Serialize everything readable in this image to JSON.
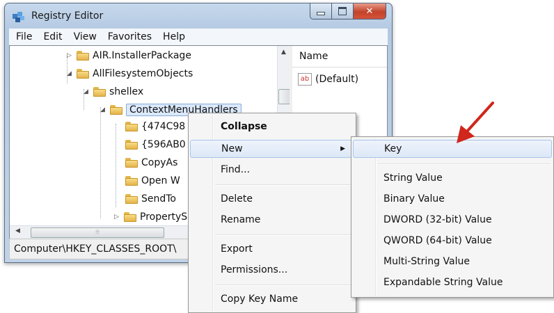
{
  "window": {
    "title": "Registry Editor",
    "menu": [
      "File",
      "Edit",
      "View",
      "Favorites",
      "Help"
    ]
  },
  "tree": {
    "nodes": [
      "AIR.InstallerPackage",
      "AllFilesystemObjects",
      "shellex",
      "ContextMenuHandlers",
      "{474C98",
      "{596AB0",
      "CopyAs",
      "Open W",
      "SendTo",
      "PropertySh"
    ]
  },
  "right_pane": {
    "column": "Name",
    "value_icon_text": "ab",
    "value_name": "(Default)"
  },
  "statusbar": {
    "path": "Computer\\HKEY_CLASSES_ROOT\\"
  },
  "context_menu": {
    "items": [
      "Collapse",
      "New",
      "Find...",
      "Delete",
      "Rename",
      "Export",
      "Permissions...",
      "Copy Key Name"
    ]
  },
  "submenu": {
    "items": [
      "Key",
      "String Value",
      "Binary Value",
      "DWORD (32-bit) Value",
      "QWORD (64-bit) Value",
      "Multi-String Value",
      "Expandable String Value"
    ]
  },
  "colors": {
    "arrow": "#d0261c",
    "selection": "#dbe9fb",
    "close_button": "#c2422a"
  }
}
